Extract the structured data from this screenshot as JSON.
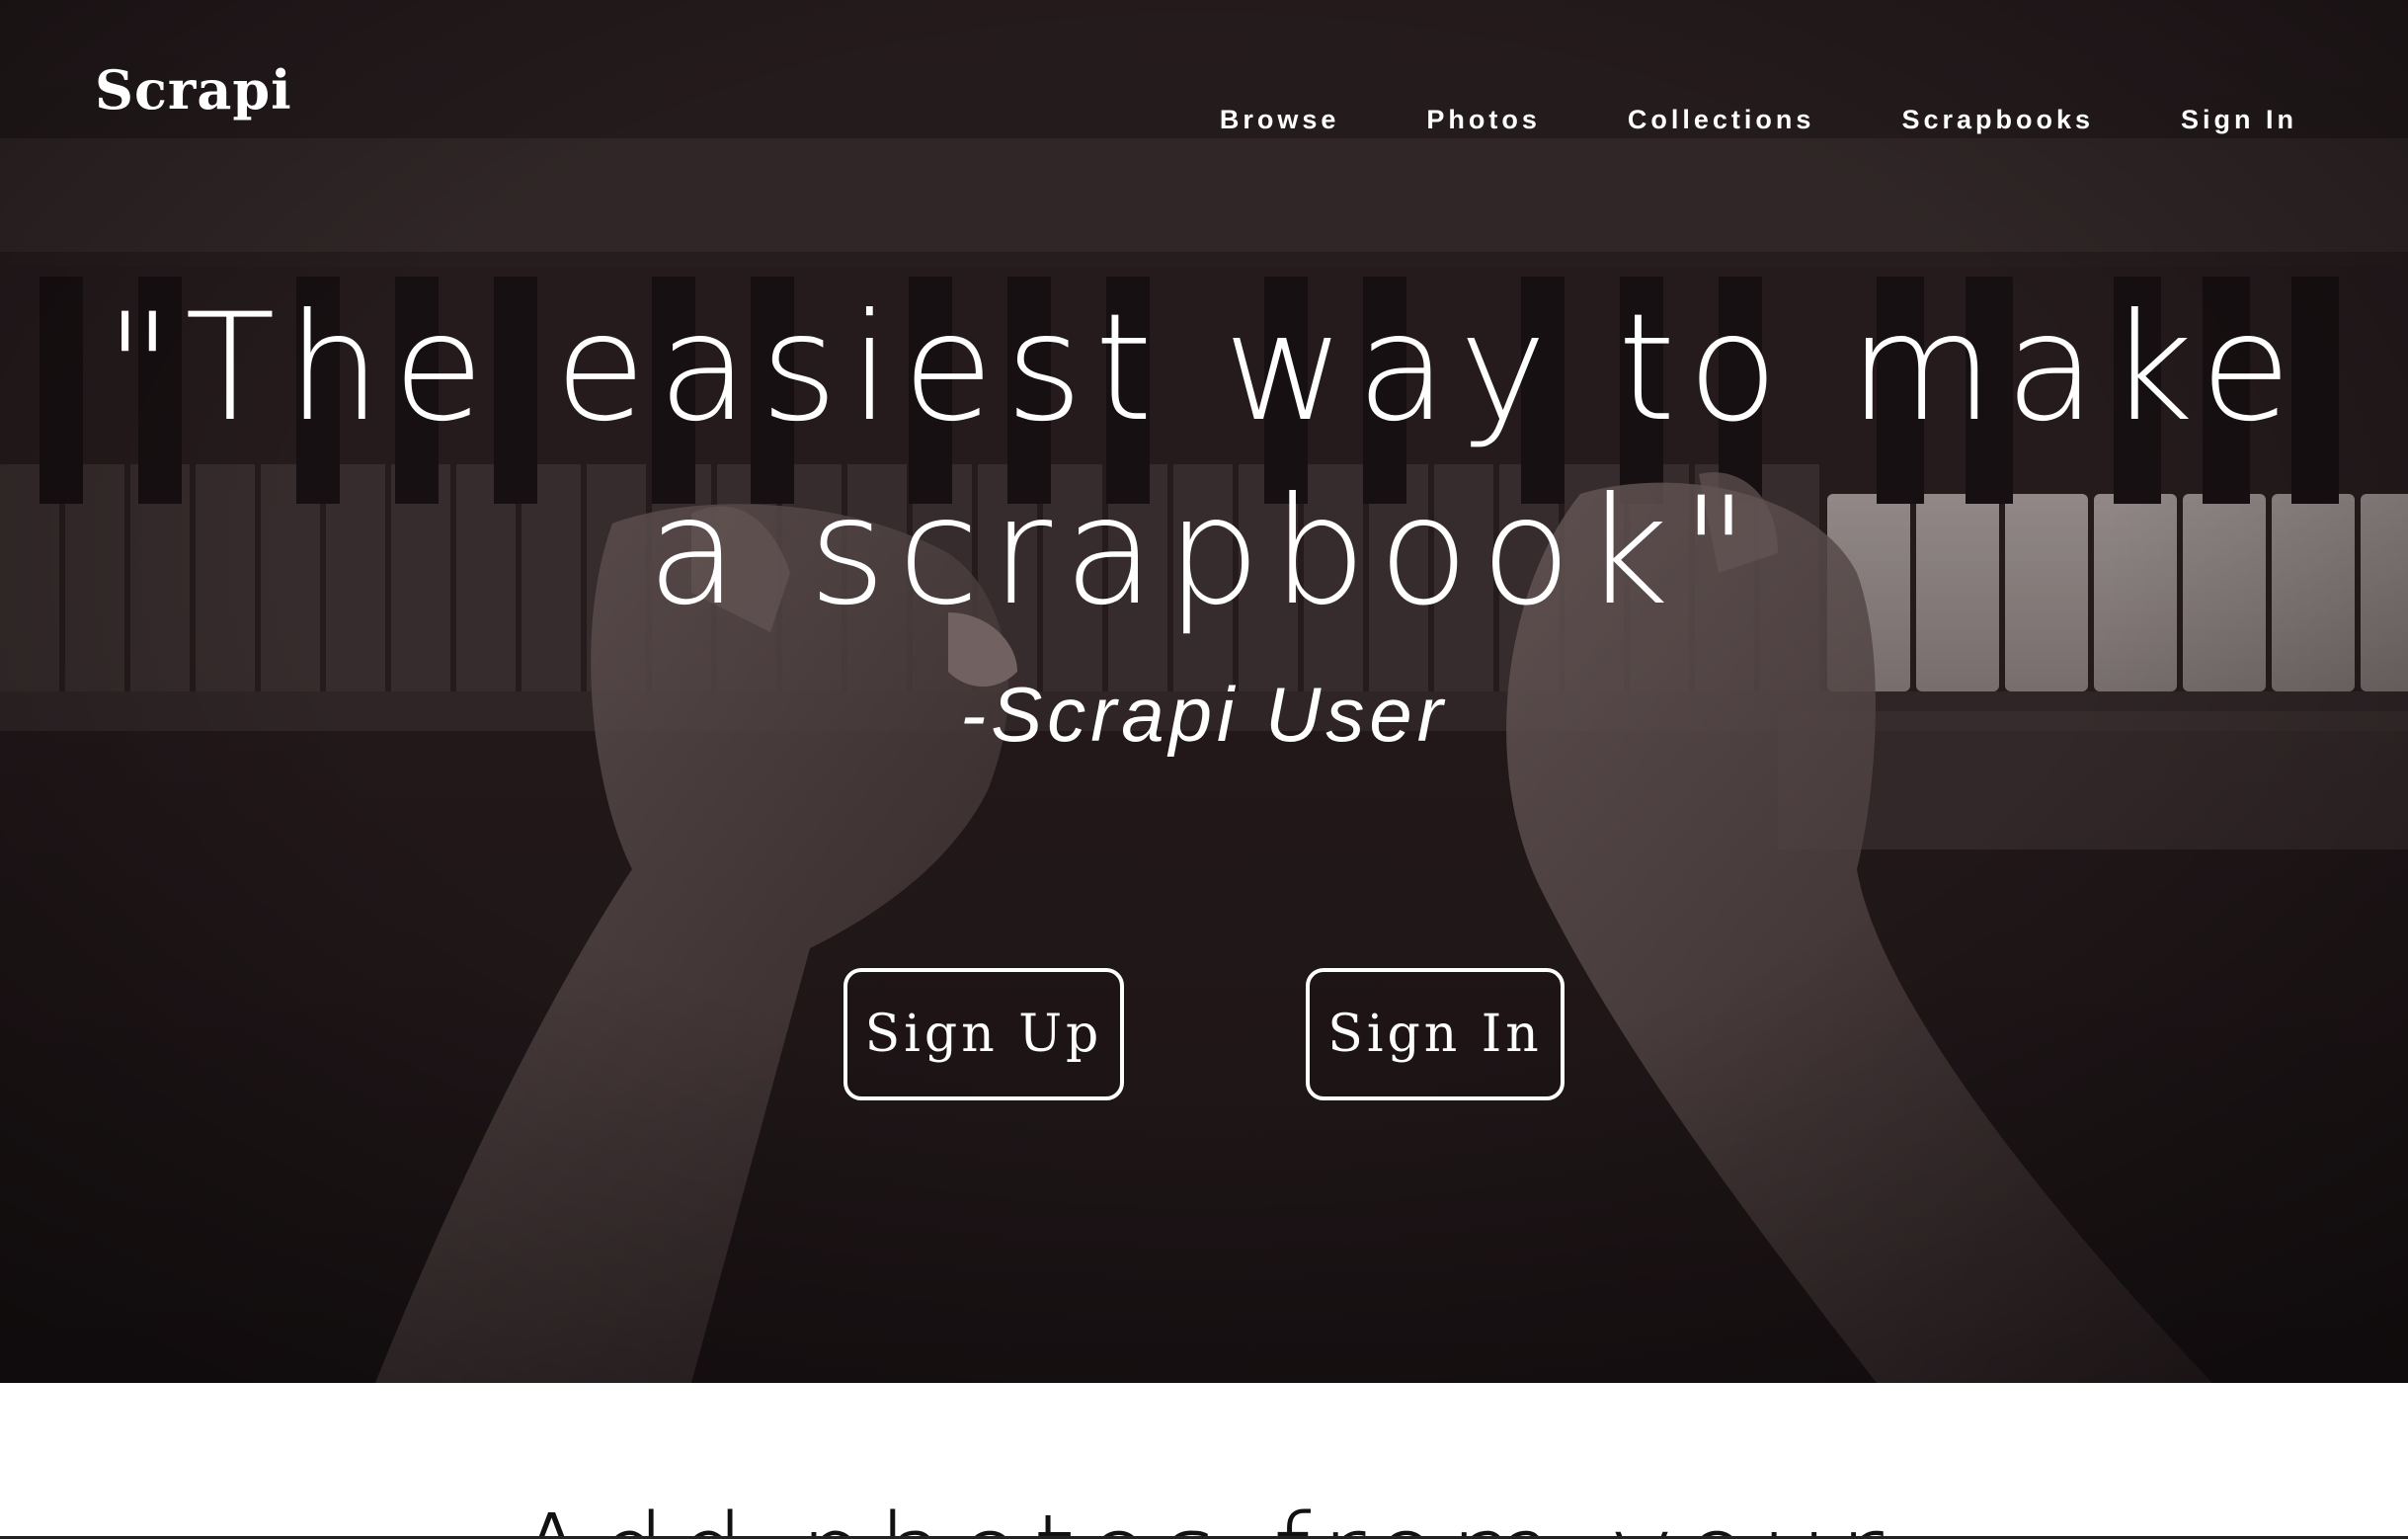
{
  "brand": {
    "logo": "Scrapi"
  },
  "nav": {
    "items": [
      "Browse",
      "Photos",
      "Collections",
      "Scrapbooks",
      "Sign In"
    ]
  },
  "hero": {
    "quote_line_1": "\"The easiest way to make",
    "quote_line_2": "a scrapbook\"",
    "attribution": "-Scrapi User",
    "signup_label": "Sign Up",
    "signin_label": "Sign In",
    "background_subject": "hands-playing-piano-photo"
  },
  "section": {
    "heading": "Add photos from your"
  },
  "colors": {
    "hero_overlay": "#241b1c",
    "text_light": "#ffffff",
    "page_bg": "#ffffff"
  }
}
